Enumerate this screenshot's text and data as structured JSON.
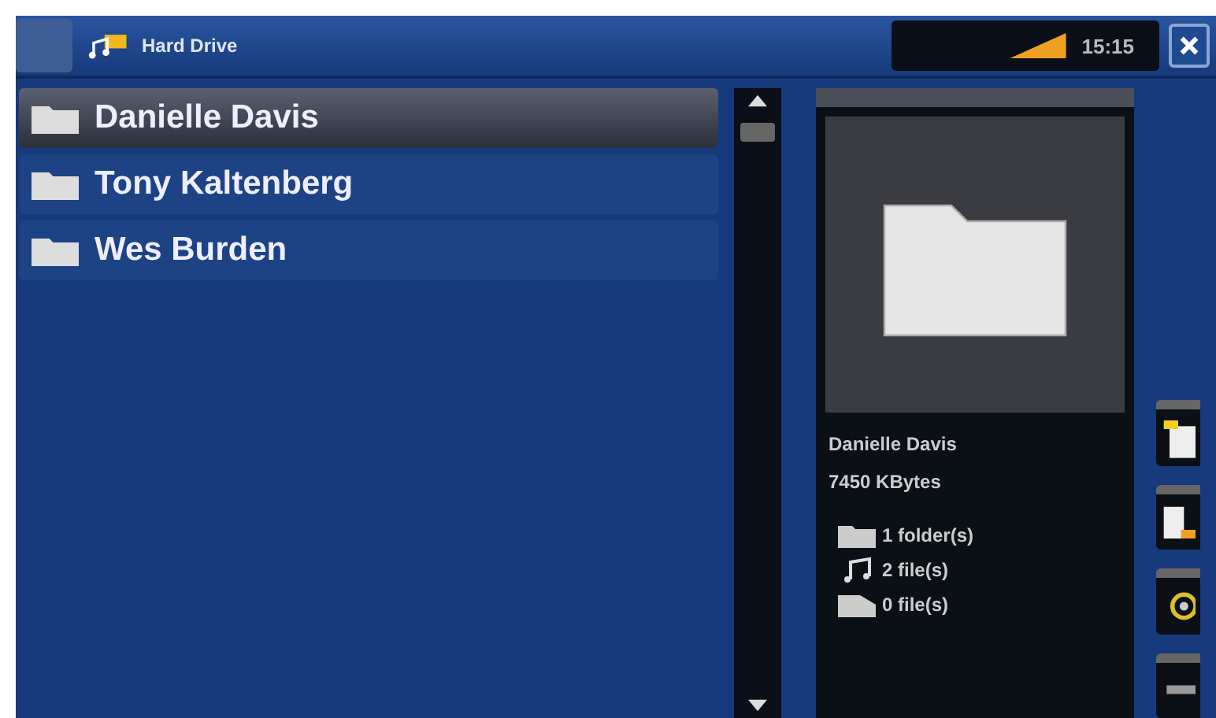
{
  "top_bar": {
    "title": "Hard Drive",
    "clock": "15:15"
  },
  "folders": [
    {
      "name": "Danielle Davis",
      "selected": true
    },
    {
      "name": "Tony Kaltenberg",
      "selected": false
    },
    {
      "name": "Wes Burden",
      "selected": false
    }
  ],
  "info": {
    "name": "Danielle Davis",
    "size": "7450 KBytes",
    "counts": [
      {
        "kind": "folder",
        "text": "1 folder(s)"
      },
      {
        "kind": "music",
        "text": "2 file(s)"
      },
      {
        "kind": "video",
        "text": "0 file(s)"
      }
    ]
  },
  "side_buttons": [
    {
      "kind": "note"
    },
    {
      "kind": "edit"
    },
    {
      "kind": "settings"
    },
    {
      "kind": "more"
    }
  ]
}
